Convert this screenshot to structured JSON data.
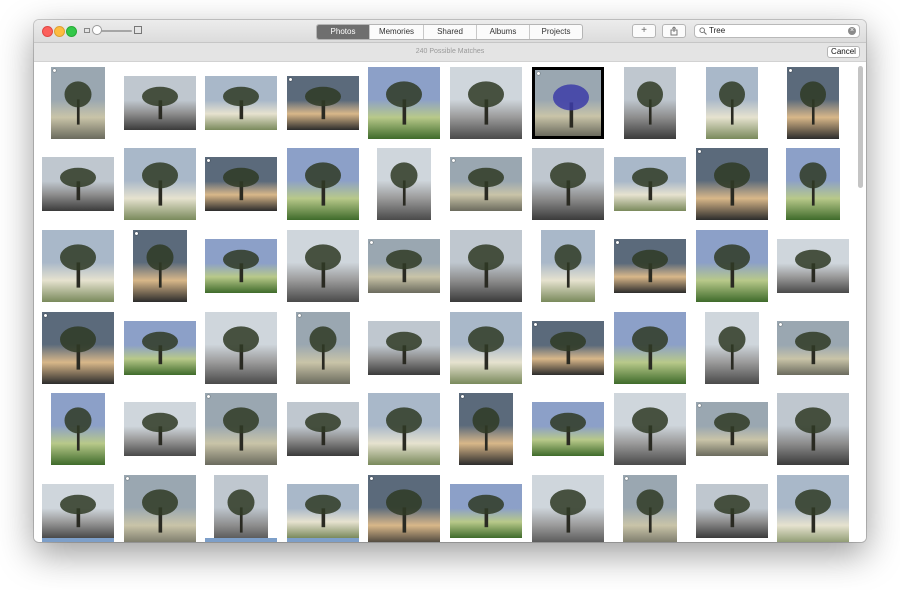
{
  "window": {
    "tabs": [
      {
        "label": "Photos"
      },
      {
        "label": "Memories"
      },
      {
        "label": "Shared"
      },
      {
        "label": "Albums"
      },
      {
        "label": "Projects"
      }
    ],
    "active_tab": "Photos",
    "search": {
      "value": "Tree"
    },
    "add_button": "+",
    "matches_text": "240 Possible Matches",
    "cancel_label": "Cancel"
  },
  "colors": {
    "accent_active_segment": "#6f6f6f",
    "close": "#fc605c",
    "minimize": "#fdbc40",
    "zoom": "#34c84a"
  },
  "photos": [
    [
      {
        "desc": "tree trunk close-up",
        "pin": false,
        "shape": "portrait",
        "style": "bordered-none"
      },
      {
        "desc": "bare branches silhouette",
        "pin": false,
        "shape": "landscape"
      },
      {
        "desc": "tree in mist",
        "pin": false,
        "shape": "landscape"
      },
      {
        "desc": "snowy field with trees",
        "pin": true,
        "shape": "landscape"
      },
      {
        "desc": "tree silhouette at dusk",
        "pin": false,
        "shape": "square"
      },
      {
        "desc": "dark branches",
        "pin": false,
        "shape": "square"
      },
      {
        "desc": "blue tree on hill",
        "pin": false,
        "shape": "square",
        "selected": true
      },
      {
        "desc": "tree on green hill",
        "pin": true,
        "shape": "square"
      },
      {
        "desc": "tree on green hill",
        "pin": true,
        "shape": "square"
      },
      {
        "desc": "tree on green hill",
        "pin": true,
        "shape": "square"
      }
    ]
  ]
}
